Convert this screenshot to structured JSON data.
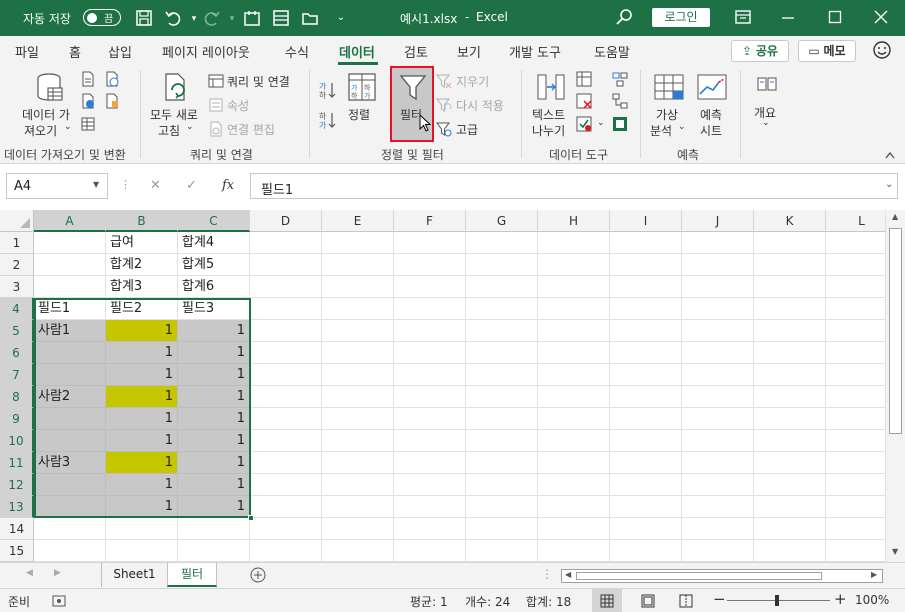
{
  "titlebar": {
    "autosave_label": "자동 저장",
    "autosave_state": "끔",
    "filename": "예시1.xlsx",
    "separator": "-",
    "app": "Excel",
    "login": "로그인"
  },
  "menu": {
    "tabs": [
      "파일",
      "홈",
      "삽입",
      "페이지 레이아웃",
      "수식",
      "데이터",
      "검토",
      "보기",
      "개발 도구",
      "도움말"
    ],
    "active_tab": "데이터",
    "share": "공유",
    "memo": "메모"
  },
  "ribbon": {
    "get_data_line1": "데이터 가",
    "get_data_line2": "져오기",
    "refresh_line1": "모두 새로",
    "refresh_line2": "고침",
    "query_conn": "쿼리 및 연결",
    "properties": "속성",
    "edit_links": "연결 편집",
    "sort": "정렬",
    "filter": "필터",
    "clear": "지우기",
    "reapply": "다시 적용",
    "advanced": "고급",
    "text_to_col_line1": "텍스트",
    "text_to_col_line2": "나누기",
    "whatif_line1": "가상",
    "whatif_line2": "분석",
    "forecast_line1": "예측",
    "forecast_line2": "시트",
    "outline": "개요",
    "groups": {
      "get_transform": "데이터 가져오기 및 변환",
      "queries": "쿼리 및 연결",
      "sort_filter": "정렬 및 필터",
      "data_tools": "데이터 도구",
      "forecast": "예측"
    }
  },
  "formula_bar": {
    "name_box": "A4",
    "cancel": "✕",
    "enter": "✓",
    "fx": "fx",
    "content": "필드1"
  },
  "columns": [
    "A",
    "B",
    "C",
    "D",
    "E",
    "F",
    "G",
    "H",
    "I",
    "J",
    "K",
    "L"
  ],
  "rows": [
    "1",
    "2",
    "3",
    "4",
    "5",
    "6",
    "7",
    "8",
    "9",
    "10",
    "11",
    "12",
    "13",
    "14",
    "15"
  ],
  "cells": {
    "B1": "급여",
    "C1": "합계4",
    "B2": "합계2",
    "C2": "합계5",
    "B3": "합계3",
    "C3": "합계6",
    "A4": "필드1",
    "B4": "필드2",
    "C4": "필드3",
    "A5": "사람1",
    "B5": "1",
    "C5": "1",
    "B6": "1",
    "C6": "1",
    "B7": "1",
    "C7": "1",
    "A8": "사람2",
    "B8": "1",
    "C8": "1",
    "B9": "1",
    "C9": "1",
    "B10": "1",
    "C10": "1",
    "A11": "사람3",
    "B11": "1",
    "C11": "1",
    "B12": "1",
    "C12": "1",
    "B13": "1",
    "C13": "1"
  },
  "colors": {
    "excel_green": "#1e7145",
    "gray_fill": "#c8c8c8",
    "yellow_fill": "#c6c600",
    "highlight_border": "#e81123"
  },
  "sheets": [
    "Sheet1",
    "필터"
  ],
  "active_sheet": "필터",
  "status": {
    "ready": "준비",
    "average": "평균: 1",
    "count": "개수: 24",
    "sum": "합계: 18",
    "zoom": "100%"
  }
}
